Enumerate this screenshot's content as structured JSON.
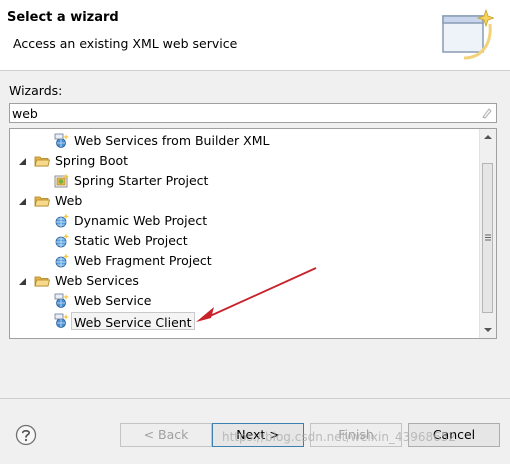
{
  "header": {
    "title": "Select a wizard",
    "description": "Access an existing XML web service",
    "banner_icon": "wizard-banner-icon"
  },
  "wizards_label": "Wizards:",
  "filter": {
    "value": "web"
  },
  "tree": {
    "items": [
      {
        "label": "Web Services from Builder XML",
        "level": 1,
        "icon": "webservice-wizard-icon"
      },
      {
        "label": "Spring Boot",
        "level": 0,
        "icon": "folder-icon",
        "expanded": true
      },
      {
        "label": "Spring Starter Project",
        "level": 1,
        "icon": "spring-project-icon"
      },
      {
        "label": "Web",
        "level": 0,
        "icon": "folder-icon",
        "expanded": true
      },
      {
        "label": "Dynamic Web Project",
        "level": 1,
        "icon": "web-project-icon"
      },
      {
        "label": "Static Web Project",
        "level": 1,
        "icon": "web-project-icon"
      },
      {
        "label": "Web Fragment Project",
        "level": 1,
        "icon": "web-project-icon"
      },
      {
        "label": "Web Services",
        "level": 0,
        "icon": "folder-icon",
        "expanded": true
      },
      {
        "label": "Web Service",
        "level": 1,
        "icon": "webservice-wizard-icon"
      },
      {
        "label": "Web Service Client",
        "level": 1,
        "icon": "webservice-wizard-icon",
        "selected": true
      }
    ]
  },
  "buttons": {
    "back": "< Back",
    "next": "Next >",
    "finish": "Finish",
    "cancel": "Cancel"
  },
  "watermark": "https://blog.csdn.net/weixin_43968652",
  "colors": {
    "annotation_arrow": "#c8222b",
    "folder": "#e8b648",
    "default_button_border": "#3c7fb1"
  }
}
